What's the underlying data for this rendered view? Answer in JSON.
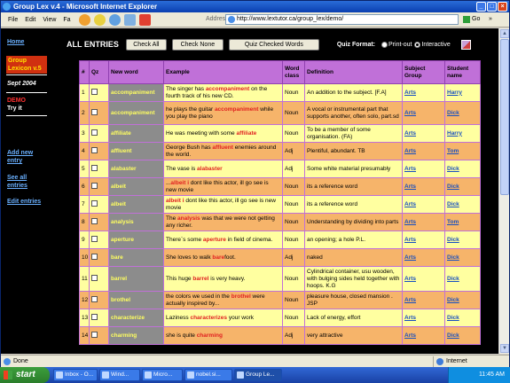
{
  "window": {
    "title": "Group Lex v.4 - Microsoft Internet Explorer"
  },
  "menu": [
    "File",
    "Edit",
    "View",
    "Fa"
  ],
  "address": {
    "label": "Address",
    "url": "http://www.lextutor.ca/group_lex/demo/",
    "go": "Go",
    "links": "»"
  },
  "sidebar": {
    "home": "Home",
    "group_lexicon": "Group Lexicon v.5",
    "date": "Sept 2004",
    "demo": "DEMO",
    "try": "Try it",
    "add_new": "Add new entry",
    "see_all": "See all entries",
    "edit": "Edit entries"
  },
  "topbar": {
    "heading": "ALL ENTRIES",
    "check_all": "Check All",
    "check_none": "Check None",
    "quiz_checked": "Quiz Checked Words",
    "quiz_format": "Quiz Format:",
    "print_out": "Print-out",
    "interactive": "Interactive"
  },
  "table": {
    "headers": [
      "#",
      "Qz",
      "New word",
      "Example",
      "Word class",
      "Definition",
      "Subject Group",
      "Student name"
    ],
    "rows": [
      {
        "n": "1",
        "word": "accompaniment",
        "ex_pre": "The singer has ",
        "ex_hl": "accompaniment",
        "ex_post": " on the fourth track of his new CD.",
        "cls": "Noun",
        "def": "An addition to the subject. [F.A]",
        "subj": "Arts",
        "stud": "Harry"
      },
      {
        "n": "2",
        "word": "accompaniment",
        "ex_pre": "he plays the guitar ",
        "ex_hl": "accompaniment",
        "ex_post": " while you play the piano",
        "cls": "Noun",
        "def": "A vocal or instrumental part that supports another, often solo, part.sd",
        "subj": "Arts",
        "stud": "Dick"
      },
      {
        "n": "3",
        "word": "affiliate",
        "ex_pre": "He was meeting with some ",
        "ex_hl": "affiliate",
        "ex_post": "",
        "cls": "Noun",
        "def": "To be a member of some organisation. (FA)",
        "subj": "Arts",
        "stud": "Harry"
      },
      {
        "n": "4",
        "word": "affluent",
        "ex_pre": "George Bush has ",
        "ex_hl": "affluent",
        "ex_post": " enemies around the world.",
        "cls": "Adj",
        "def": "Plentiful, abundant. TB",
        "subj": "Arts",
        "stud": "Tom"
      },
      {
        "n": "5",
        "word": "alabaster",
        "ex_pre": "The vase is ",
        "ex_hl": "alabaster",
        "ex_post": "",
        "cls": "Adj",
        "def": "Some white material presumably",
        "subj": "Arts",
        "stud": "Dick"
      },
      {
        "n": "6",
        "word": "albeit",
        "ex_pre": "...",
        "ex_hl": "albeit i",
        "ex_post": " dont like this actor, ill go see is new movie",
        "cls": "Noun",
        "def": "its a reference word",
        "subj": "Arts",
        "stud": "Dick"
      },
      {
        "n": "7",
        "word": "albeit",
        "ex_pre": "",
        "ex_hl": "albeit i",
        "ex_post": " dont like this actor, ill go see is new movie",
        "cls": "Noun",
        "def": "its a reference word",
        "subj": "Arts",
        "stud": "Dick"
      },
      {
        "n": "8",
        "word": "analysis",
        "ex_pre": "The ",
        "ex_hl": "analysis",
        "ex_post": " was that we were not getting any richer.",
        "cls": "Noun",
        "def": "Understanding by dividing into parts",
        "subj": "Arts",
        "stud": "Tom"
      },
      {
        "n": "9",
        "word": "aperture",
        "ex_pre": "There`s some ",
        "ex_hl": "aperture",
        "ex_post": " in field of cinema.",
        "cls": "Noun",
        "def": "an opening; a hole P.L.",
        "subj": "Arts",
        "stud": "Dick"
      },
      {
        "n": "10",
        "word": "bare",
        "ex_pre": "She loves to walk ",
        "ex_hl": "bare",
        "ex_post": "foot.",
        "cls": "Adj",
        "def": "naked",
        "subj": "Arts",
        "stud": "Dick"
      },
      {
        "n": "11",
        "word": "barrel",
        "ex_pre": "This huge ",
        "ex_hl": "barrel",
        "ex_post": " is very heavy.",
        "cls": "Noun",
        "def": "Cylindrical container, usu wooden, with bulging sides held together with hoops. K.G",
        "subj": "Arts",
        "stud": "Dick"
      },
      {
        "n": "12",
        "word": "brothel",
        "ex_pre": "the colors we used in the ",
        "ex_hl": "brothel",
        "ex_post": " were actually inspired by...",
        "cls": "Noun",
        "def": "pleasure house, closed mansion . JSP",
        "subj": "Arts",
        "stud": "Dick"
      },
      {
        "n": "13",
        "word": "characterize",
        "ex_pre": "Laziness ",
        "ex_hl": "characterizes",
        "ex_post": " your work",
        "cls": "Noun",
        "def": "Lack of energy, effort",
        "subj": "Arts",
        "stud": "Dick"
      },
      {
        "n": "14",
        "word": "charming",
        "ex_pre": "she is quite ",
        "ex_hl": "charming",
        "ex_post": "",
        "cls": "Adj",
        "def": "very attractive",
        "subj": "Arts",
        "stud": "Dick"
      }
    ]
  },
  "status": {
    "left": "Done",
    "zone": "Internet"
  },
  "taskbar": {
    "start": "start",
    "tasks": [
      "Inbox - O...",
      "Wind...",
      "Micro...",
      "nobel.si...",
      "Group Le..."
    ],
    "clock": "11:45 AM"
  }
}
